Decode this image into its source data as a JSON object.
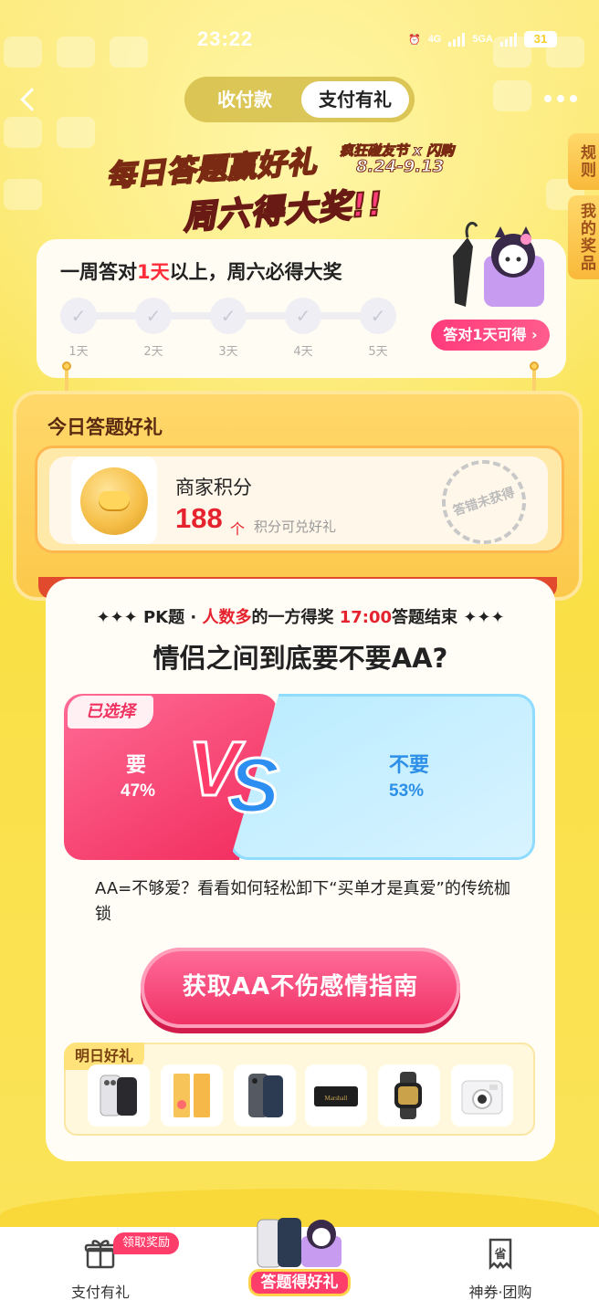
{
  "status_bar": {
    "time": "23:22",
    "net1": "4G",
    "net2": "5GA",
    "battery": "31"
  },
  "top_nav": {
    "segments": [
      "收付款",
      "支付有礼"
    ],
    "active_segment": "支付有礼"
  },
  "side_tabs": [
    "规则",
    "我的奖品"
  ],
  "banner": {
    "title_line1": "每日答题赢好礼",
    "title_line2": "周六得大奖!!",
    "promo": "疯狂碰友节 x 闪购",
    "dates": "8.24-9.13"
  },
  "week_card": {
    "title_prefix": "一周答对",
    "title_highlight": "1天",
    "title_suffix": "以上，周六必得大奖",
    "days": [
      "1天",
      "2天",
      "3天",
      "4天",
      "5天"
    ],
    "gift_button": "答对1天可得 ›"
  },
  "today_card": {
    "title": "今日答题好礼",
    "reward_name": "商家积分",
    "reward_value": "188",
    "reward_unit": "个",
    "reward_note": "积分可兑好礼",
    "stamp": "答错未获得"
  },
  "question": {
    "head_prefix": "✦✦✦ PK题 · ",
    "head_red": "人数多",
    "head_mid": "的一方得奖 ",
    "head_time": "17:00",
    "head_suffix": "答题结束 ✦✦✦",
    "text": "情侣之间到底要不要AA?",
    "selected_badge": "已选择",
    "option_left": {
      "label": "要",
      "percent": "47%"
    },
    "option_right": {
      "label": "不要",
      "percent": "53%"
    },
    "vs_v": "V",
    "vs_s": "S",
    "description": "AA=不够爱？看看如何轻松卸下“买单才是真爱”的传统枷锁",
    "guide_button": "获取AA不伤感情指南"
  },
  "tomorrow": {
    "title": "明日好礼",
    "products": [
      "iphone-icon",
      "red-envelope-icon",
      "phone-icon",
      "speaker-icon",
      "smartwatch-icon",
      "instant-camera-icon"
    ]
  },
  "bottom_nav": {
    "left": "支付有礼",
    "left_tag": "领取奖励",
    "center": "答题得好礼",
    "right": "神券·团购",
    "right_icon_text": "省"
  },
  "colors": {
    "accent_pink": "#f02f64",
    "accent_blue": "#2d8fe8",
    "background_yellow": "#fbe24d"
  }
}
